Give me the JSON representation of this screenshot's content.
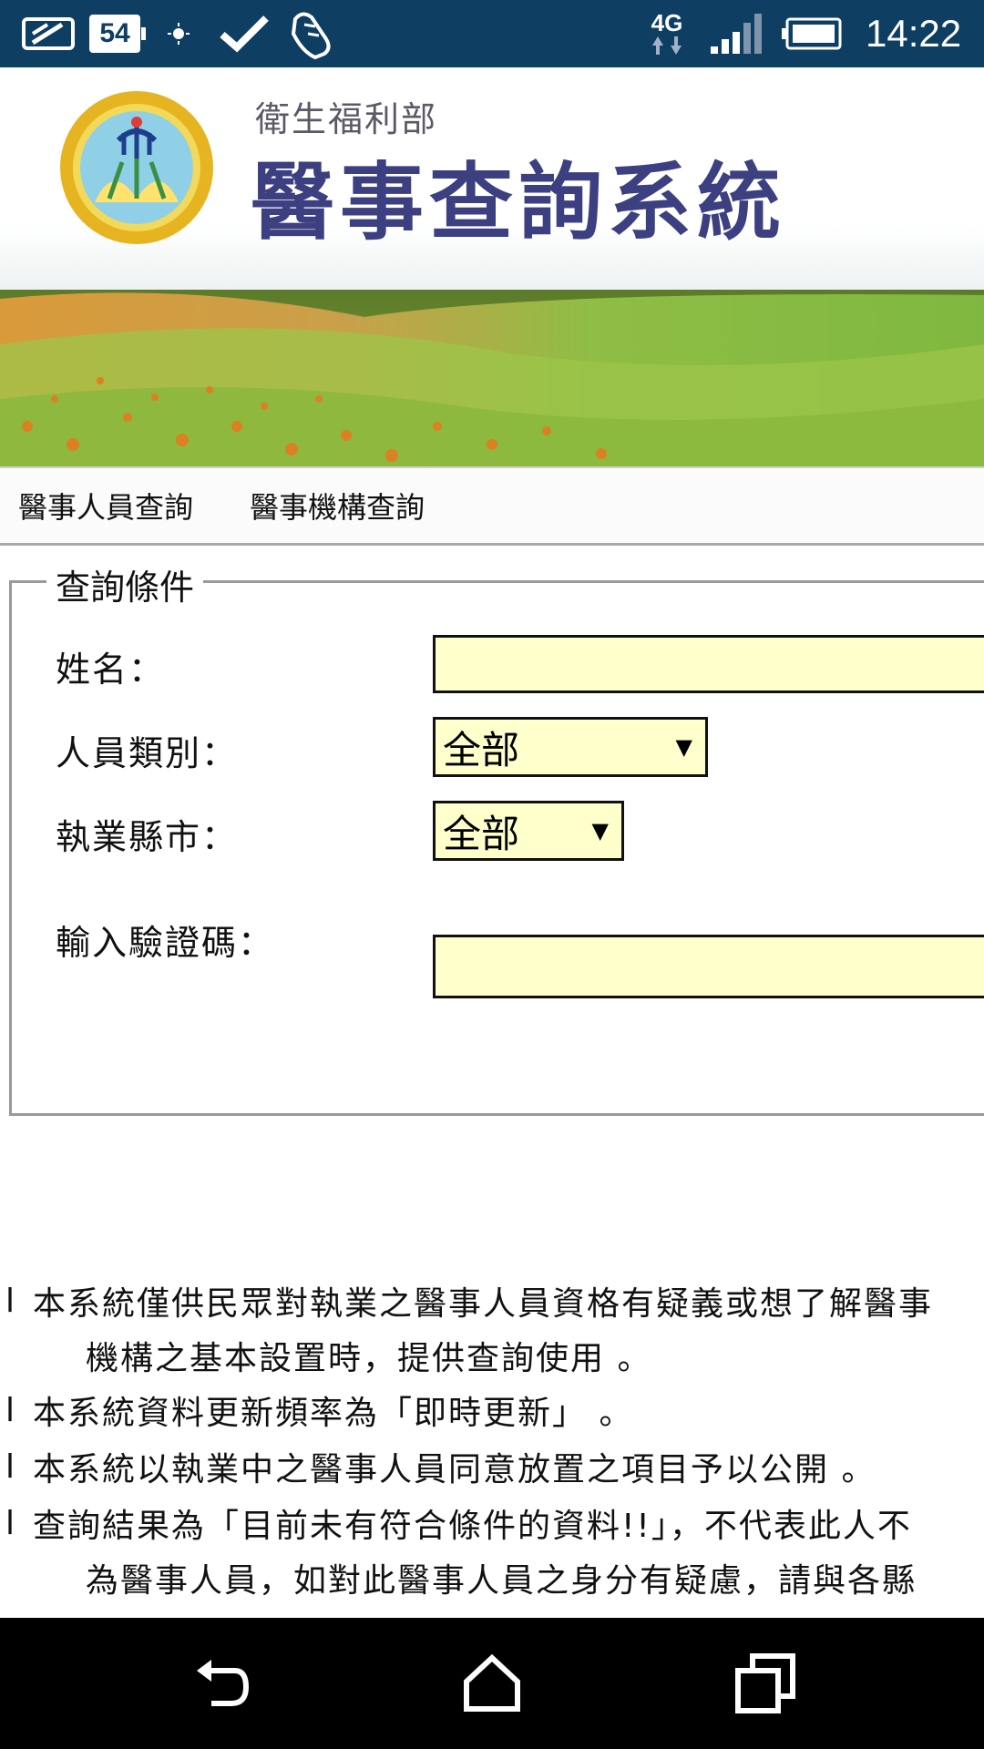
{
  "status_bar": {
    "battery_badge": "54",
    "network": "4G",
    "time": "14:22",
    "icons": [
      "message-icon",
      "battery-badge",
      "brightness-icon",
      "check-icon",
      "running-icon",
      "network-4g-icon",
      "signal-icon",
      "battery-icon"
    ]
  },
  "header": {
    "ministry": "衛生福利部",
    "title": "醫事查詢系統",
    "logo_text": "衛生福利部"
  },
  "nav": {
    "items": [
      {
        "label": "醫事人員查詢"
      },
      {
        "label": "醫事機構查詢"
      }
    ]
  },
  "form": {
    "legend": "查詢條件",
    "name_label": "姓名：",
    "name_value": "",
    "category_label": "人員類別：",
    "category_value": "全部",
    "city_label": "執業縣市：",
    "city_value": "全部",
    "captcha_label": "輸入驗證碼：",
    "captcha_value": ""
  },
  "notes": {
    "bullet": "l",
    "n1_line1": "本系統僅供民眾對執業之醫事人員資格有疑義或想了解醫事",
    "n1_line2": "機構之基本設置時，提供查詢使用 。",
    "n2": "本系統資料更新頻率為「即時更新」 。",
    "n3": "本系統以執業中之醫事人員同意放置之項目予以公開 。",
    "n4_line1": "查詢結果為「目前未有符合條件的資料!!」，不代表此人不",
    "n4_line2": "為醫事人員，如對此醫事人員之身分有疑慮，請與各縣"
  },
  "colors": {
    "status_bar": "#0f3e63",
    "input_bg": "#ffffcc",
    "title": "#3c3f80"
  }
}
